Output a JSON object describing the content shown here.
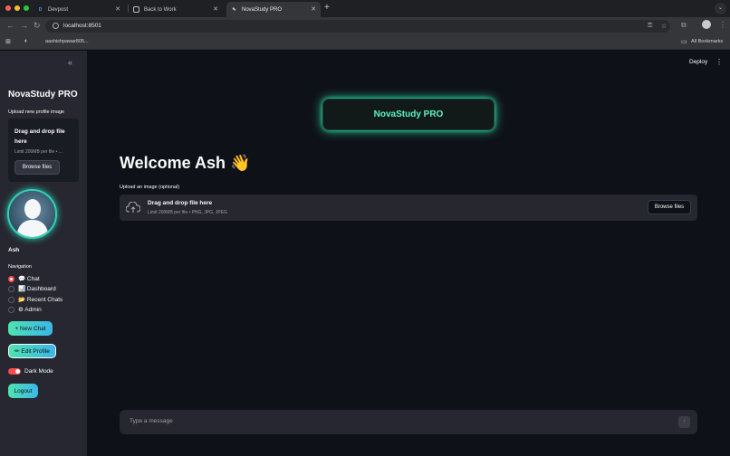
{
  "browser": {
    "tabs": [
      {
        "label": "Devpost",
        "favicon": "D"
      },
      {
        "label": "Back to Work",
        "favicon": "⊡"
      },
      {
        "label": "NovaStudy PRO",
        "favicon": "✎"
      }
    ],
    "new_tab": "+",
    "url": "localhost:8501",
    "bookmark": "aashishpawar805...",
    "all_bookmarks": "All Bookmarks"
  },
  "sidebar": {
    "collapse_icon": "«",
    "title": "NovaStudy PRO",
    "upload_label": "Upload new profile image",
    "uploader_text": "Drag and drop file here",
    "uploader_hint": "Limit 200MB per file • ...",
    "browse_label": "Browse files",
    "username": "Ash",
    "nav_label": "Navigation",
    "nav_items": [
      {
        "label": "💬 Chat",
        "selected": true
      },
      {
        "label": "📊 Dashboard",
        "selected": false
      },
      {
        "label": "📂 Recent Chats",
        "selected": false
      },
      {
        "label": "⚙ Admin",
        "selected": false
      }
    ],
    "new_chat": "+ New Chat",
    "edit_profile": "✏ Edit Profile",
    "dark_mode": "Dark Mode",
    "logout": "Logout"
  },
  "main": {
    "deploy": "Deploy",
    "hero": "NovaStudy PRO",
    "welcome": "Welcome Ash 👋",
    "upload_label": "Upload an image (optional)",
    "uploader_text": "Drag and drop file here",
    "uploader_hint": "Limit 200MB per file • PNG, JPG, JPEG",
    "browse_label": "Browse files",
    "chat_placeholder": "Type a message"
  },
  "colors": {
    "accent": "#2fd3b5",
    "primary": "#ff4b4b",
    "background": "#0e1117",
    "sidebar": "#262730"
  }
}
